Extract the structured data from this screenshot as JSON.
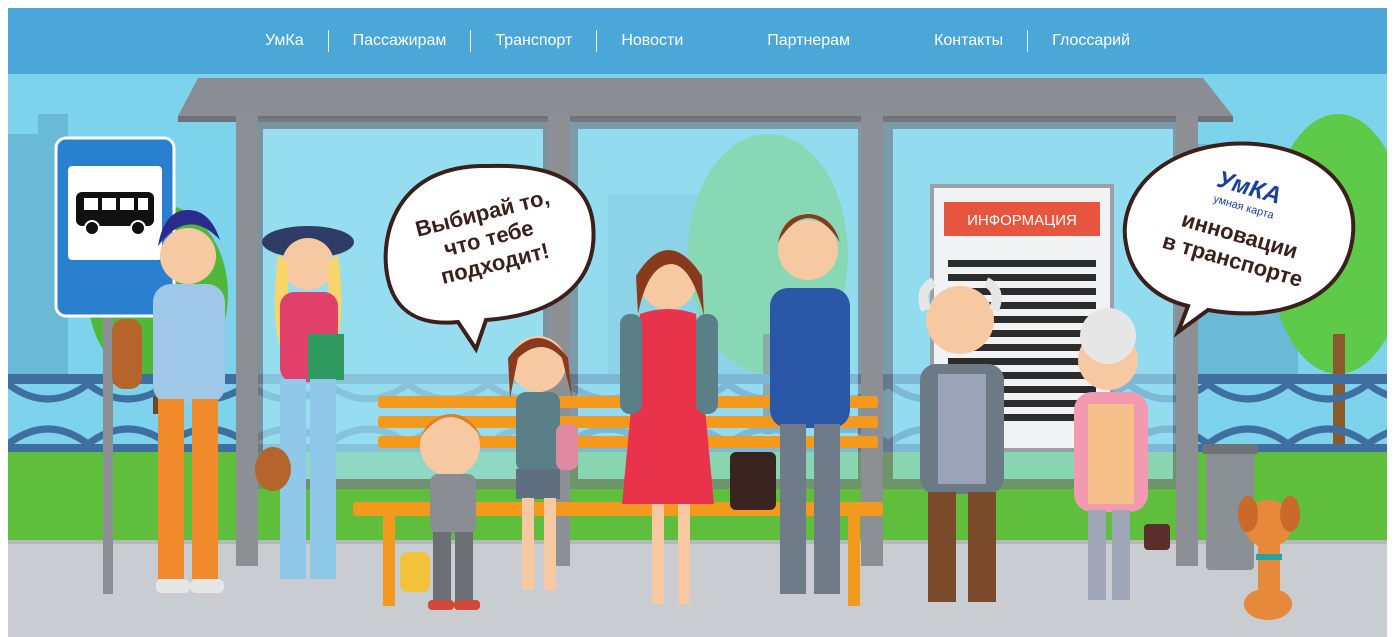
{
  "nav": {
    "items": [
      {
        "label": "УмКа"
      },
      {
        "label": "Пассажирам"
      },
      {
        "label": "Транспорт"
      },
      {
        "label": "Новости"
      },
      {
        "label": "Партнерам"
      },
      {
        "label": "Контакты"
      },
      {
        "label": "Глоссарий"
      }
    ]
  },
  "banner": {
    "bubble_left": {
      "line1": "Выбирай то,",
      "line2": "что тебе",
      "line3": "подходит!"
    },
    "info_sign": "ИНФОРМАЦИЯ",
    "bubble_right": {
      "brand": "УмКА",
      "brand_sub": "умная карта",
      "line1": "инновации",
      "line2": "в транспорте"
    }
  },
  "colors": {
    "nav_bg": "#4aa7d8",
    "sky": "#7ed3ec",
    "grass": "#5fbf3c",
    "pavement": "#c9cdd1",
    "roof": "#8a8e94",
    "bench": "#f39a1e",
    "info_red": "#e8553f"
  },
  "icons": [
    "bus-stop-sign-icon",
    "info-sign-icon",
    "umka-logo-icon",
    "dog-illustration-icon"
  ]
}
